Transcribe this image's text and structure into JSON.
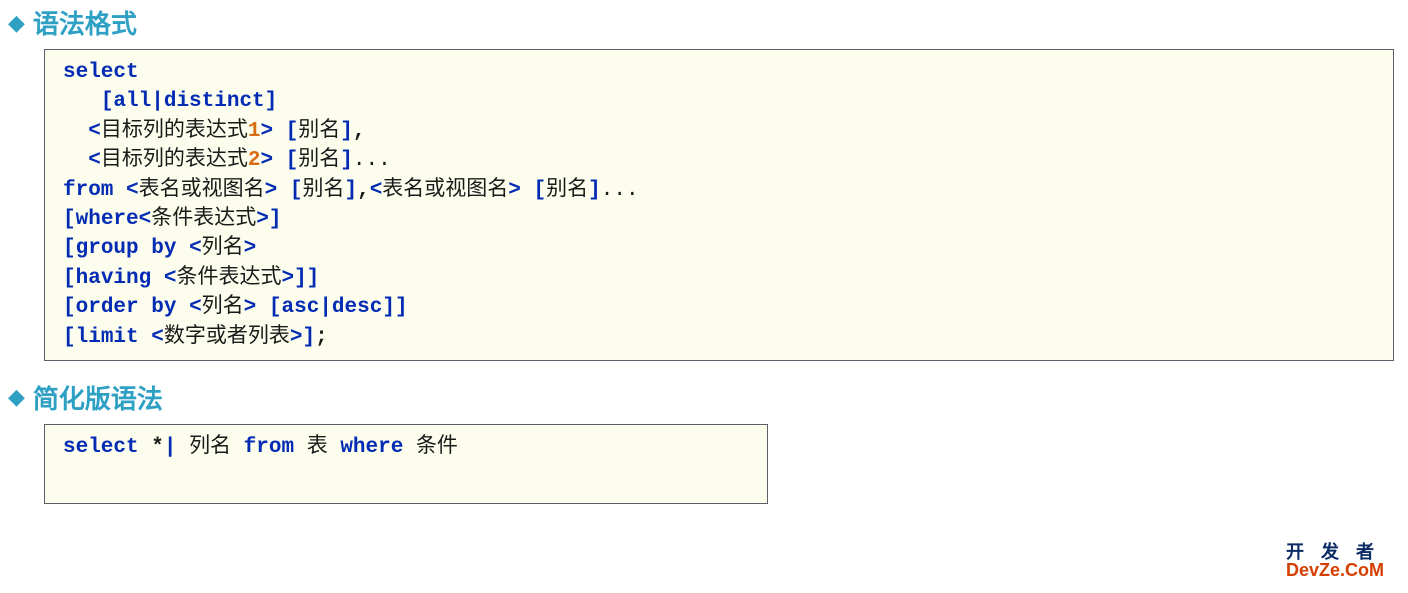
{
  "headings": {
    "h1": "语法格式",
    "h2": "简化版语法"
  },
  "code1": {
    "l1_select": "select",
    "l2_open": "[",
    "l2_all": "all",
    "l2_pipe": "|",
    "l2_distinct": "distinct",
    "l2_close": "]",
    "l3_lt": "<",
    "l3_txt": "目标列的表达式",
    "l3_num": "1",
    "l3_gt": ">",
    "l3_open": "[",
    "l3_alias": "别名",
    "l3_close": "]",
    "l3_comma": ",",
    "l4_lt": "<",
    "l4_txt": "目标列的表达式",
    "l4_num": "2",
    "l4_gt": ">",
    "l4_open": "[",
    "l4_alias": "别名",
    "l4_close": "]",
    "l4_dots": "...",
    "l5_from": "from",
    "l5_lt1": "<",
    "l5_tv1": "表名或视图名",
    "l5_gt1": ">",
    "l5_open1": "[",
    "l5_al1": "别名",
    "l5_close1": "]",
    "l5_comma": ",",
    "l5_lt2": "<",
    "l5_tv2": "表名或视图名",
    "l5_gt2": ">",
    "l5_open2": "[",
    "l5_al2": "别名",
    "l5_close2": "]",
    "l5_dots": "...",
    "l6_open": "[",
    "l6_where": "where",
    "l6_lt": "<",
    "l6_cond": "条件表达式",
    "l6_gt": ">",
    "l6_close": "]",
    "l7_open": "[",
    "l7_group": "group",
    "l7_by": "by",
    "l7_lt": "<",
    "l7_col": "列名",
    "l7_gt": ">",
    "l8_open": "[",
    "l8_having": "having",
    "l8_lt": "<",
    "l8_cond": "条件表达式",
    "l8_gt": ">",
    "l8_close1": "]",
    "l8_close2": "]",
    "l9_open": "[",
    "l9_order": "order",
    "l9_by": "by",
    "l9_lt": "<",
    "l9_col": "列名",
    "l9_gt": ">",
    "l9_open2": "[",
    "l9_asc": "asc",
    "l9_pipe": "|",
    "l9_desc": "desc",
    "l9_close2": "]",
    "l9_close": "]",
    "l10_open": "[",
    "l10_limit": "limit",
    "l10_lt": "<",
    "l10_nl": "数字或者列表",
    "l10_gt": ">",
    "l10_close": "]",
    "l10_semi": ";"
  },
  "code2": {
    "select": "select",
    "star": "*",
    "pipe": "|",
    "col": "列名",
    "from": "from",
    "tbl": "表",
    "where": "where",
    "cond": "条件"
  },
  "watermark": {
    "line1": "开 发 者",
    "line2": "DevZe.CoM"
  }
}
